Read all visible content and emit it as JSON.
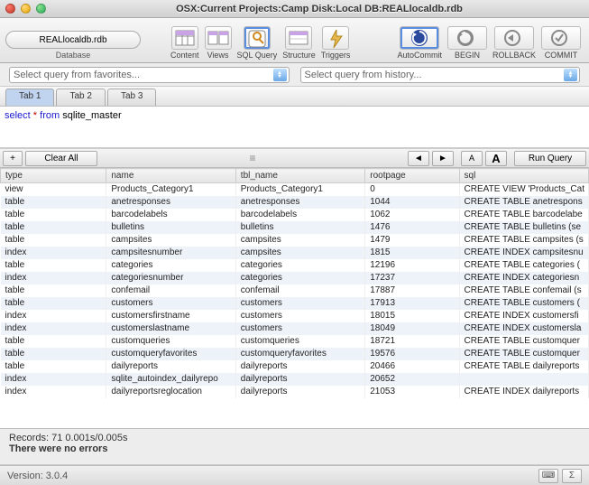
{
  "window": {
    "title": "OSX:Current Projects:Camp Disk:Local DB:REALlocaldb.rdb"
  },
  "database_selector": {
    "label": "REALlocaldb.rdb",
    "caption": "Database"
  },
  "toolbar": [
    {
      "name": "content-button",
      "label": "Content"
    },
    {
      "name": "views-button",
      "label": "Views"
    },
    {
      "name": "sqlquery-button",
      "label": "SQL Query",
      "selected": true
    },
    {
      "name": "structure-button",
      "label": "Structure"
    },
    {
      "name": "triggers-button",
      "label": "Triggers"
    }
  ],
  "toolbar_right": [
    {
      "name": "autocommit-button",
      "label": "AutoCommit",
      "selected": true
    },
    {
      "name": "begin-button",
      "label": "BEGIN"
    },
    {
      "name": "rollback-button",
      "label": "ROLLBACK"
    },
    {
      "name": "commit-button",
      "label": "COMMIT"
    }
  ],
  "favorites": {
    "placeholder": "Select query from favorites..."
  },
  "history": {
    "placeholder": "Select query from history..."
  },
  "editor_tabs": [
    {
      "label": "Tab 1",
      "active": true
    },
    {
      "label": "Tab 2"
    },
    {
      "label": "Tab 3"
    }
  ],
  "query_parts": {
    "select": "select",
    "star": " * ",
    "from": "from",
    "rest": " sqlite_master"
  },
  "buttons": {
    "add": "+",
    "clear": "Clear All",
    "prev": "◄",
    "next": "►",
    "font_small": "A",
    "font_big": "A",
    "run": "Run Query"
  },
  "columns": [
    "type",
    "name",
    "tbl_name",
    "rootpage",
    "sql"
  ],
  "rows": [
    [
      "view",
      "Products_Category1",
      "Products_Category1",
      "0",
      "CREATE VIEW 'Products_Cat"
    ],
    [
      "table",
      "anetresponses",
      "anetresponses",
      "1044",
      "CREATE TABLE anetrespons"
    ],
    [
      "table",
      "barcodelabels",
      "barcodelabels",
      "1062",
      "CREATE TABLE barcodelabe"
    ],
    [
      "table",
      "bulletins",
      "bulletins",
      "1476",
      "CREATE TABLE bulletins (se"
    ],
    [
      "table",
      "campsites",
      "campsites",
      "1479",
      "CREATE TABLE campsites (s"
    ],
    [
      "index",
      "campsitesnumber",
      "campsites",
      "1815",
      "CREATE INDEX campsitesnu"
    ],
    [
      "table",
      "categories",
      "categories",
      "12196",
      "CREATE TABLE categories ("
    ],
    [
      "index",
      "categoriesnumber",
      "categories",
      "17237",
      "CREATE INDEX categoriesn"
    ],
    [
      "table",
      "confemail",
      "confemail",
      "17887",
      "CREATE TABLE confemail (s"
    ],
    [
      "table",
      "customers",
      "customers",
      "17913",
      "CREATE TABLE customers ("
    ],
    [
      "index",
      "customersfirstname",
      "customers",
      "18015",
      "CREATE INDEX customersfi"
    ],
    [
      "index",
      "customerslastname",
      "customers",
      "18049",
      "CREATE INDEX customersla"
    ],
    [
      "table",
      "customqueries",
      "customqueries",
      "18721",
      "CREATE TABLE customquer"
    ],
    [
      "table",
      "customqueryfavorites",
      "customqueryfavorites",
      "19576",
      "CREATE TABLE customquer"
    ],
    [
      "table",
      "dailyreports",
      "dailyreports",
      "20466",
      "CREATE TABLE dailyreports"
    ],
    [
      "index",
      "sqlite_autoindex_dailyrepo",
      "dailyreports",
      "20652",
      ""
    ],
    [
      "index",
      "dailyreportsreglocation",
      "dailyreports",
      "21053",
      "CREATE INDEX dailyreports"
    ]
  ],
  "status": {
    "records": "Records: 71   0.001s/0.005s",
    "errors": "There were no errors"
  },
  "footer": {
    "version": "Version: 3.0.4",
    "sigma": "Σ"
  }
}
